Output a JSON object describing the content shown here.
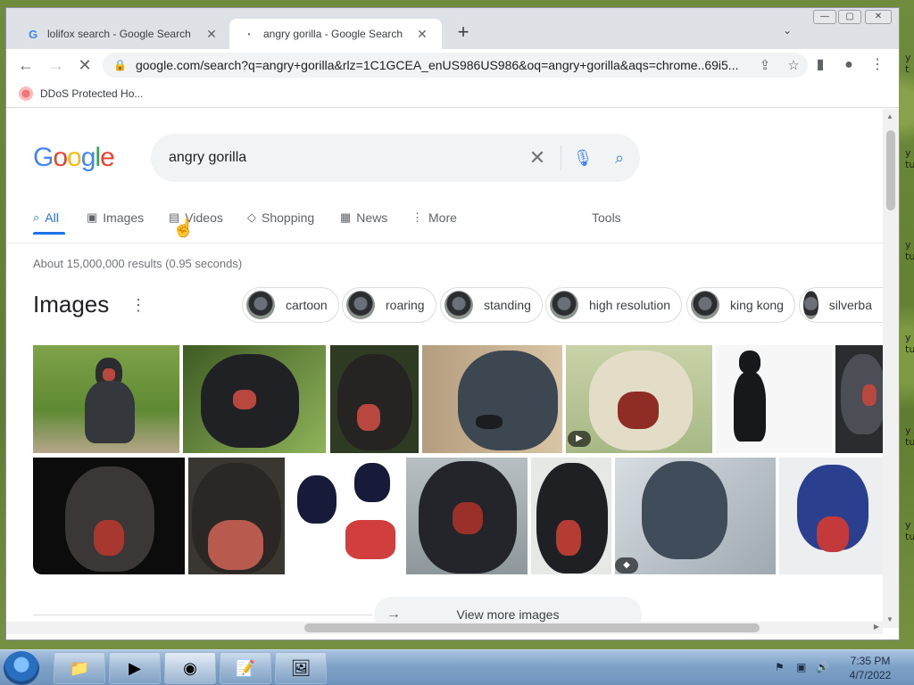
{
  "browser": {
    "tabs": [
      {
        "title": "lolifox search - Google Search",
        "favicon": "G"
      },
      {
        "title": "angry gorilla - Google Search",
        "favicon": "loading-dot"
      }
    ],
    "new_tab": "+",
    "url": "google.com/search?q=angry+gorilla&rlz=1C1GCEA_enUS986US986&oq=angry+gorilla&aqs=chrome..69i5...",
    "bookmark": "DDoS Protected Ho..."
  },
  "search": {
    "query": "angry gorilla",
    "logo": [
      "G",
      "o",
      "o",
      "g",
      "l",
      "e"
    ],
    "logo_colors": [
      "#4285f4",
      "#ea4335",
      "#fbbc05",
      "#4285f4",
      "#34a853",
      "#ea4335"
    ]
  },
  "nav_tabs": [
    {
      "label": "All",
      "icon": "search-icon"
    },
    {
      "label": "Images",
      "icon": "image-icon"
    },
    {
      "label": "Videos",
      "icon": "video-icon"
    },
    {
      "label": "Shopping",
      "icon": "tag-icon"
    },
    {
      "label": "News",
      "icon": "news-icon"
    },
    {
      "label": "More",
      "icon": "more-vert-icon"
    }
  ],
  "tools": "Tools",
  "result_stats": "About 15,000,000 results (0.95 seconds)",
  "images_section": {
    "heading": "Images",
    "chips": [
      "cartoon",
      "roaring",
      "standing",
      "high resolution",
      "king kong",
      "silverba"
    ],
    "view_more": "View more images"
  },
  "desktop_fragments": [
    "y t",
    "y tu",
    "y tu",
    "y tu",
    "y tu",
    "y tu"
  ],
  "taskbar": {
    "clock_time": "7:35 PM",
    "clock_date": "4/7/2022"
  },
  "colors": {
    "accent": "#1a73e8",
    "taskbar": "#7fa2c8"
  }
}
